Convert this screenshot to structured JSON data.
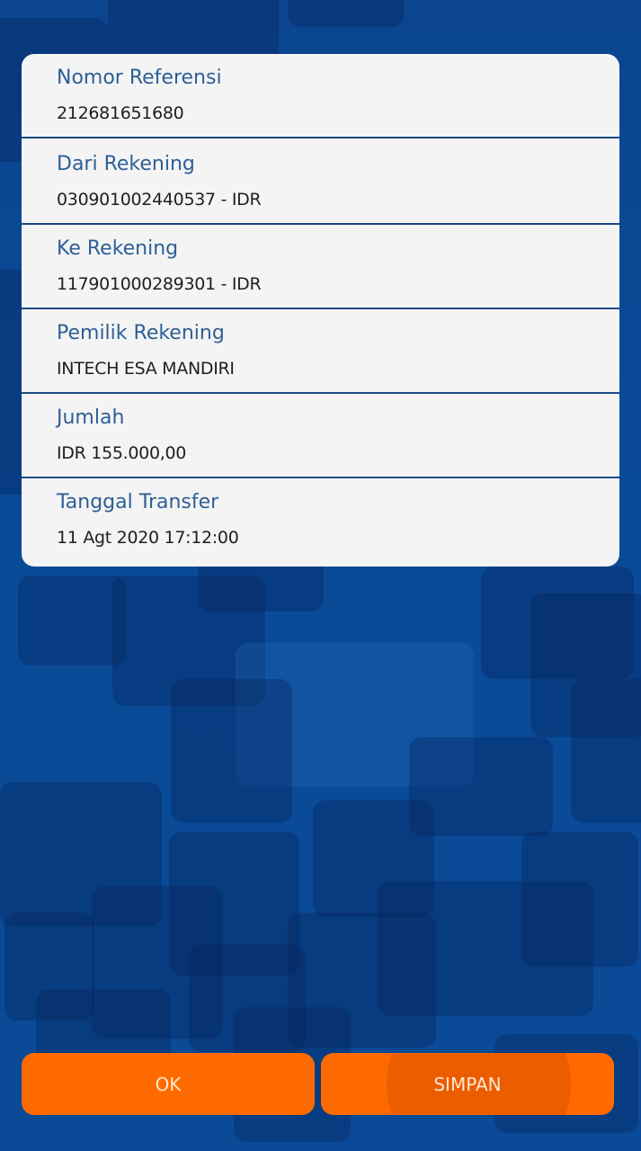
{
  "fields": [
    {
      "label": "Nomor Referensi",
      "value": "212681651680"
    },
    {
      "label": "Dari Rekening",
      "value": "030901002440537 - IDR"
    },
    {
      "label": "Ke Rekening",
      "value": "117901000289301 - IDR"
    },
    {
      "label": "Pemilik Rekening",
      "value": "INTECH ESA MANDIRI"
    },
    {
      "label": "Jumlah",
      "value": "IDR 155.000,00"
    },
    {
      "label": "Tanggal Transfer",
      "value": "11 Agt 2020 17:12:00"
    }
  ],
  "buttons": {
    "ok_label": "OK",
    "save_label": "SIMPAN"
  },
  "colors": {
    "background": "#0a4a94",
    "card": "#f4f4f4",
    "label_text": "#2e5f96",
    "divider": "#1d4a86",
    "button": "#ff6a00"
  }
}
